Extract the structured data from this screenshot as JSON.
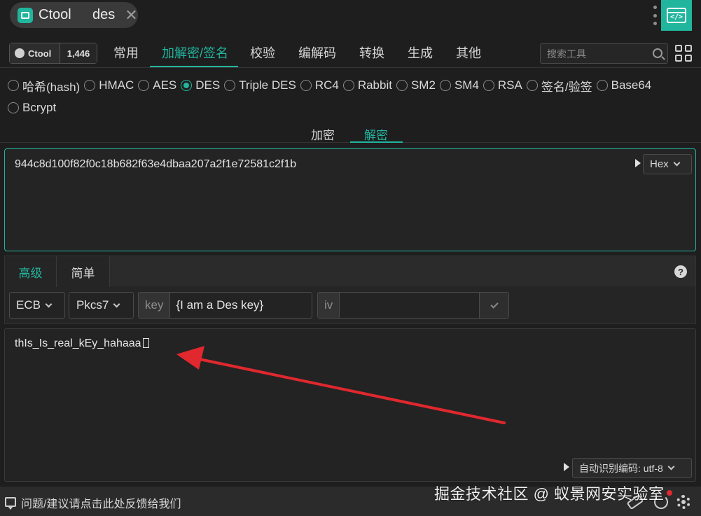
{
  "titlebar": {
    "app_tab": "Ctool",
    "doc_tab": "des",
    "close_glyph": "✕"
  },
  "nav": {
    "github": {
      "name": "Ctool",
      "stars": "1,446"
    },
    "items": [
      "常用",
      "加解密/签名",
      "校验",
      "编解码",
      "转换",
      "生成",
      "其他"
    ],
    "active": "加解密/签名",
    "search_placeholder": "搜索工具"
  },
  "algorithms": {
    "row1": [
      "哈希(hash)",
      "HMAC",
      "AES",
      "DES",
      "Triple DES",
      "RC4",
      "Rabbit",
      "SM2",
      "SM4",
      "RSA",
      "签名/验签",
      "Base64"
    ],
    "row2": [
      "Bcrypt"
    ],
    "selected": "DES"
  },
  "mode_tabs": {
    "encrypt": "加密",
    "decrypt": "解密",
    "active": "解密"
  },
  "input": {
    "value": "944c8d100f82f0c18b682f63e4dbaa207a2f1e72581c2f1b",
    "format": "Hex"
  },
  "settings": {
    "tabs": {
      "advanced": "高级",
      "simple": "简单"
    },
    "help": "?",
    "mode": "ECB",
    "padding": "Pkcs7",
    "key_label": "key",
    "key_value": "{I am a Des key}",
    "iv_label": "iv",
    "iv_value": ""
  },
  "output": {
    "value": "thIs_Is_real_kEy_hahaaa",
    "encoding": "自动识别编码: utf-8"
  },
  "statusbar": {
    "feedback": "问题/建议请点击此处反馈给我们",
    "watermark": "掘金技术社区 @ 蚁景网安实验室"
  },
  "colors": {
    "accent": "#22b59e",
    "annotation_arrow": "#e0282e",
    "background": "#1e1e1e"
  },
  "icons": [
    "app-logo-icon",
    "close-icon",
    "kebab-menu-icon",
    "code-view-icon",
    "github-icon",
    "search-icon",
    "grid-icon",
    "play-icon",
    "chevron-down-icon",
    "help-icon",
    "check-icon",
    "feedback-icon",
    "eraser-icon",
    "history-icon",
    "gear-icon"
  ]
}
